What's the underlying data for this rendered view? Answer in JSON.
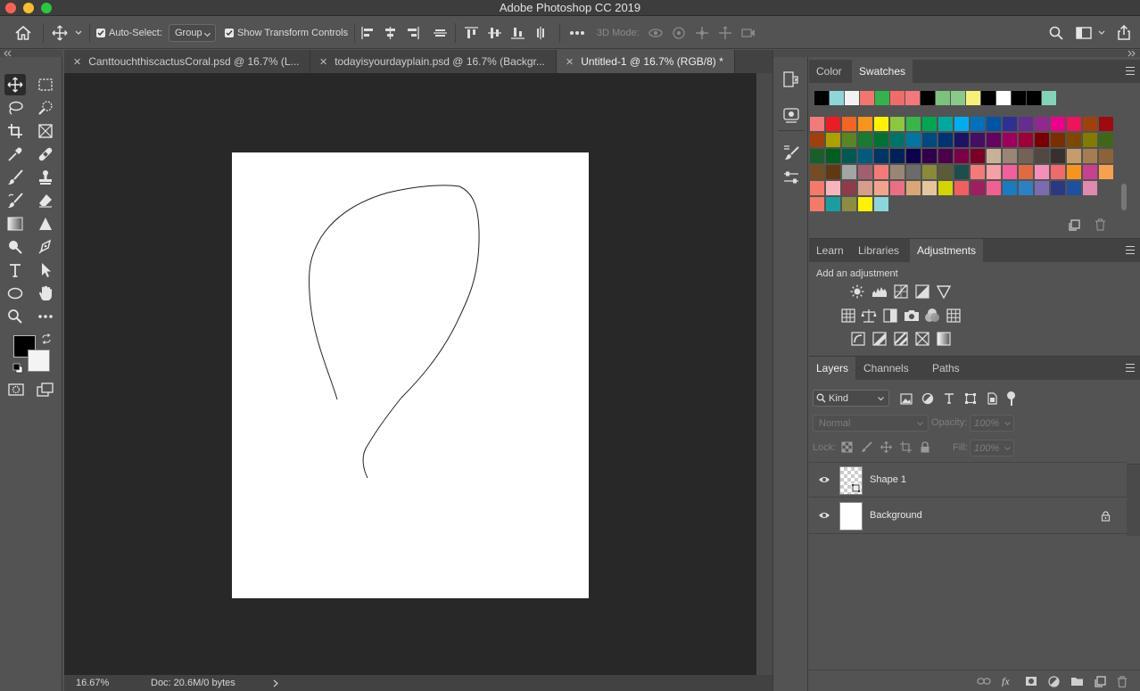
{
  "window": {
    "title": "Adobe Photoshop CC 2019",
    "traffic_colors": [
      "#fd5f57",
      "#febc2e",
      "#28c840"
    ]
  },
  "options_bar": {
    "auto_select_label": "Auto-Select:",
    "auto_select_value": "Group",
    "transform_label": "Show Transform Controls",
    "mode_3d_label": "3D Mode:"
  },
  "tabs": [
    {
      "label": "CanttouchthiscactusCoral.psd @ 16.7% (L...",
      "active": false
    },
    {
      "label": "todayisyourdayplain.psd @ 16.7% (Backgr...",
      "active": false
    },
    {
      "label": "Untitled-1 @ 16.7% (RGB/8) *",
      "active": true
    }
  ],
  "status": {
    "zoom": "16.67%",
    "doc": "Doc: 20.6M/0 bytes"
  },
  "swatch_panel": {
    "tabs": [
      "Color",
      "Swatches"
    ],
    "active_tab": "Swatches",
    "recent": [
      "#000000",
      "#8fd6db",
      "#f2f2f2",
      "#f2766f",
      "#32b34b",
      "#f26a6a",
      "#f2787c",
      "#000000",
      "#7cc27c",
      "#8bc98b",
      "#f5f07a",
      "#000000",
      "#ffffff",
      "#000000",
      "#000000",
      "#7fd5b9"
    ],
    "rows": [
      [
        "#f37a7a",
        "#ed1c24",
        "#f26522",
        "#f7941d",
        "#fff200",
        "#8dc63f",
        "#39b54a",
        "#00a651",
        "#00a99d",
        "#00aeef",
        "#0072bc",
        "#0054a6",
        "#2e3192",
        "#662d91",
        "#92278f",
        "#ec008c",
        "#ed145b",
        "#a0410d",
        "#9e0b0f"
      ],
      [
        "#a0410d",
        "#aba000",
        "#598527",
        "#197b30",
        "#007236",
        "#00746b",
        "#0076a3",
        "#004a80",
        "#003471",
        "#1b1464",
        "#440e62",
        "#630460",
        "#9e005d",
        "#9e0039",
        "#790000",
        "#7b2e00",
        "#7d4900",
        "#827b00",
        "#406618"
      ],
      [
        "#1a5e2c",
        "#005e20",
        "#005952",
        "#005b7f",
        "#003663",
        "#002157",
        "#0d004c",
        "#32004b",
        "#4b0049",
        "#7b0046",
        "#7a0026",
        "#c7b299",
        "#998675",
        "#736357",
        "#534741",
        "#37302d",
        "#c69c6d",
        "#a67c52",
        "#8c6239"
      ],
      [
        "#754c24",
        "#603913",
        "#a3a5a4",
        "#a16070",
        "#f47a7a",
        "#998675",
        "#6b6b6b",
        "#8a8a3a",
        "#5b5b3a",
        "#1e4d4d",
        "#f47a7a",
        "#f3a0a6",
        "#f0609a",
        "#e06a41",
        "#f490b7",
        "#ef6b6b",
        "#f7941d",
        "#c6428e",
        "#f7a04f"
      ],
      [
        "#f47a6a",
        "#f8b4bc",
        "#8e3b4b",
        "#d69d8a",
        "#f1a48b",
        "#e97083",
        "#d9a775",
        "#e6c59c",
        "#d4d400",
        "#f06060",
        "#9c1f5f",
        "#f06090",
        "#1a7bbf",
        "#2e80c5",
        "#7b6bb0",
        "#2b3a80",
        "#1f50a0",
        "#e08ab0"
      ],
      [
        "#f47a6a",
        "#1b9ea0",
        "#8c8c45",
        "#fff200",
        "#8ad6db"
      ]
    ]
  },
  "adjustments_panel": {
    "tabs": [
      "Learn",
      "Libraries",
      "Adjustments"
    ],
    "active_tab": "Adjustments",
    "heading": "Add an adjustment"
  },
  "layers_panel": {
    "tabs": [
      "Layers",
      "Channels",
      "Paths"
    ],
    "active_tab": "Layers",
    "filter_value": "Kind",
    "blend_mode": "Normal",
    "opacity_label": "Opacity:",
    "opacity_value": "100%",
    "lock_label": "Lock:",
    "fill_label": "Fill:",
    "fill_value": "100%",
    "layers": [
      {
        "name": "Shape 1",
        "selected": true,
        "locked": false
      },
      {
        "name": "Background",
        "selected": false,
        "locked": true
      }
    ]
  },
  "icons": {
    "home": "home-icon",
    "move": "move-tool-icon",
    "search": "search-icon",
    "workspace": "workspace-icon",
    "share": "share-icon"
  }
}
